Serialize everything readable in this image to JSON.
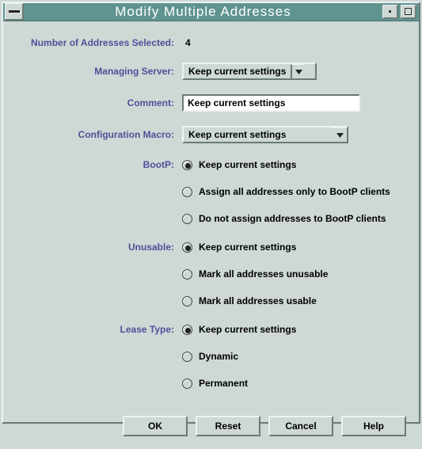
{
  "window": {
    "title": "Modify Multiple Addresses"
  },
  "fields": {
    "count_label": "Number of Addresses Selected:",
    "count_value": "4",
    "server_label": "Managing Server:",
    "server_value": "Keep current settings",
    "comment_label": "Comment:",
    "comment_value": "Keep current settings",
    "macro_label": "Configuration Macro:",
    "macro_value": "Keep current settings"
  },
  "bootp": {
    "label": "BootP:",
    "options": [
      {
        "text": "Keep current settings",
        "selected": true
      },
      {
        "text": "Assign all addresses only to BootP clients",
        "selected": false
      },
      {
        "text": "Do not assign addresses to BootP clients",
        "selected": false
      }
    ]
  },
  "unusable": {
    "label": "Unusable:",
    "options": [
      {
        "text": "Keep current settings",
        "selected": true
      },
      {
        "text": "Mark all addresses unusable",
        "selected": false
      },
      {
        "text": "Mark all addresses usable",
        "selected": false
      }
    ]
  },
  "lease": {
    "label": "Lease Type:",
    "options": [
      {
        "text": "Keep current settings",
        "selected": true
      },
      {
        "text": "Dynamic",
        "selected": false
      },
      {
        "text": "Permanent",
        "selected": false
      }
    ]
  },
  "buttons": {
    "ok": "OK",
    "reset": "Reset",
    "cancel": "Cancel",
    "help": "Help"
  }
}
